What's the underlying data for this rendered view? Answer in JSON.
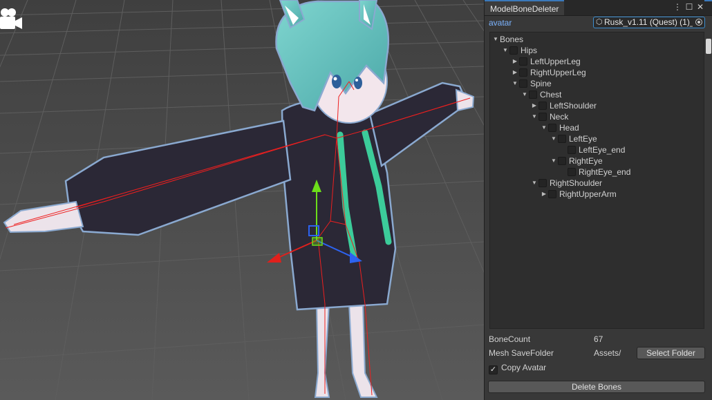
{
  "window": {
    "tab_title": "ModelBoneDeleter",
    "menu_glyph": "⋮",
    "maximize_glyph": "☐",
    "close_glyph": "✕"
  },
  "avatar_field": {
    "label": "avatar",
    "value": "Rusk_v1.11 (Quest) (1)_"
  },
  "bones_tree": [
    {
      "label": "Bones",
      "depth": 0,
      "arrow": "expanded",
      "checkbox": false
    },
    {
      "label": "Hips",
      "depth": 1,
      "arrow": "expanded",
      "checkbox": true
    },
    {
      "label": "LeftUpperLeg",
      "depth": 2,
      "arrow": "collapsed",
      "checkbox": true
    },
    {
      "label": "RightUpperLeg",
      "depth": 2,
      "arrow": "collapsed",
      "checkbox": true
    },
    {
      "label": "Spine",
      "depth": 2,
      "arrow": "expanded",
      "checkbox": true
    },
    {
      "label": "Chest",
      "depth": 3,
      "arrow": "expanded",
      "checkbox": true
    },
    {
      "label": "LeftShoulder",
      "depth": 4,
      "arrow": "collapsed",
      "checkbox": true
    },
    {
      "label": "Neck",
      "depth": 4,
      "arrow": "expanded",
      "checkbox": true
    },
    {
      "label": "Head",
      "depth": 5,
      "arrow": "expanded",
      "checkbox": true
    },
    {
      "label": "LeftEye",
      "depth": 6,
      "arrow": "expanded",
      "checkbox": true
    },
    {
      "label": "LeftEye_end",
      "depth": 7,
      "arrow": "none",
      "checkbox": true
    },
    {
      "label": "RightEye",
      "depth": 6,
      "arrow": "expanded",
      "checkbox": true
    },
    {
      "label": "RightEye_end",
      "depth": 7,
      "arrow": "none",
      "checkbox": true
    },
    {
      "label": "RightShoulder",
      "depth": 4,
      "arrow": "expanded",
      "checkbox": true
    },
    {
      "label": "RightUpperArm",
      "depth": 5,
      "arrow": "collapsed",
      "checkbox": true
    }
  ],
  "bone_count": {
    "label": "BoneCount",
    "value": "67"
  },
  "mesh_save_folder": {
    "label": "Mesh SaveFolder",
    "value": "Assets/",
    "button": "Select Folder"
  },
  "copy_avatar": {
    "label": "Copy Avatar",
    "checked": true,
    "check_glyph": "✓"
  },
  "delete_button": "Delete Bones",
  "colors": {
    "accent": "#3a79bb",
    "link_blue": "#7cb4ff",
    "panel_bg": "#383838",
    "tree_bg": "#2e2e2e",
    "gizmo_x": "#e0201c",
    "gizmo_y": "#6cde1a",
    "gizmo_z": "#2d63f0"
  },
  "icons": {
    "scene_camera": "camera-icon",
    "object_field": "object-picker-icon",
    "unity_object": "gameobject-icon"
  }
}
